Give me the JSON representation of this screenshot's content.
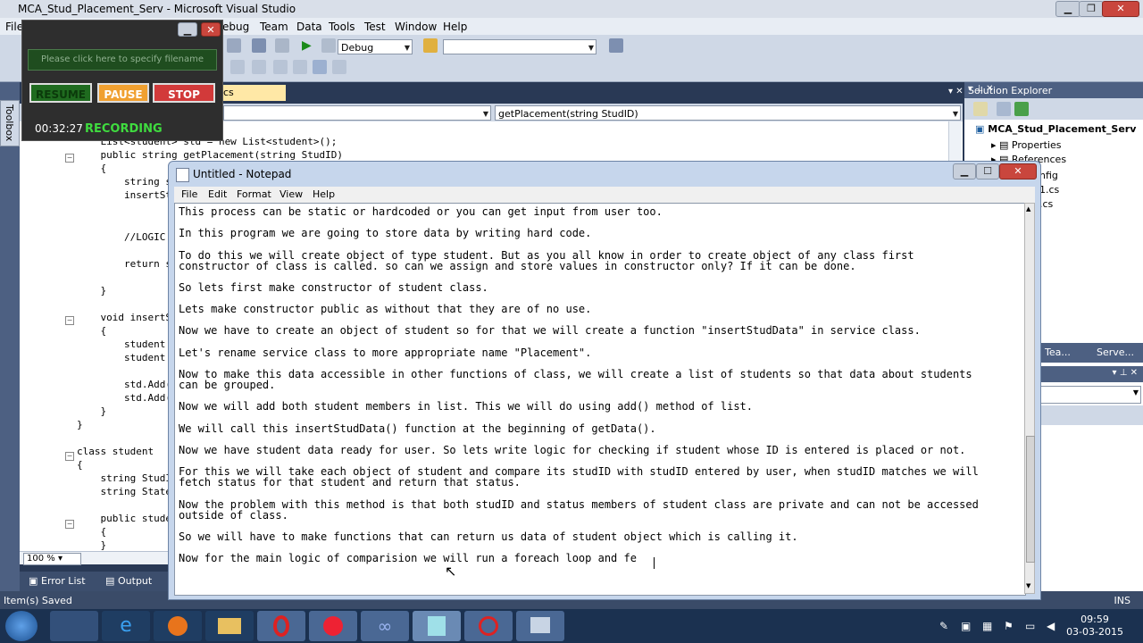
{
  "vs": {
    "title": "MCA_Stud_Placement_Serv - Microsoft Visual Studio",
    "menu": [
      "File",
      "ebug",
      "Team",
      "Data",
      "Tools",
      "Test",
      "Window",
      "Help"
    ],
    "config_combo": "Debug",
    "platform_combo": "",
    "toolbox_label": "Toolbox",
    "doc_tab": "cs",
    "member_combo": "getPlacement(string StudID)",
    "zoom": "100 %",
    "bottom_tabs": [
      "Error List",
      "Output"
    ],
    "status_left": "Item(s) Saved",
    "status_right": "INS",
    "code_lines": [
      "    List<student> std = new List<student>();",
      "    public string getPlacement(string StudID)",
      "    {",
      "        string s",
      "        insertSt",
      "",
      "        //LOGIC",
      "",
      "        return s",
      "",
      "    }",
      "",
      "    void insertS",
      "    {",
      "        student",
      "        student",
      "",
      "        std.Add(",
      "        std.Add(",
      "    }",
      "}",
      "",
      "class student",
      "{",
      "    string StudI",
      "    string State",
      "",
      "    public stude",
      "    {",
      "    }"
    ]
  },
  "solution_explorer": {
    "title": "Solution Explorer",
    "project": "MCA_Stud_Placement_Serv",
    "items": [
      "Properties",
      "References",
      "nfig",
      "1.cs",
      ".cs"
    ],
    "bottom_tabs": [
      "Tea...",
      "Serve..."
    ]
  },
  "recorder": {
    "filename_hint": "Please click here to specify filename",
    "resume": "RESUME",
    "pause": "PAUSE",
    "stop": "STOP",
    "time": "00:32:27",
    "state": "RECORDING"
  },
  "notepad": {
    "title": "Untitled - Notepad",
    "menu": [
      "File",
      "Edit",
      "Format",
      "View",
      "Help"
    ],
    "lines": [
      "This process can be static or hardcoded or you can get input from user too.",
      "In this program we are going to store data by writing hard code.",
      "To do this we will create object of type student. But as you all know in order to create object of any class first",
      "constructor of class is called. so can we assign and store values in constructor only? If it can be done.",
      "So lets first make constructor of student class.",
      "Lets make constructor public as without that they are of no use.",
      "Now we have to create an object of student so for that we will create a function \"insertStudData\" in service class.",
      "Let's rename service class to more appropriate name \"Placement\".",
      "Now to make this data accessible in other functions of class, we will create a list of students so that data about students",
      "can be grouped.",
      "Now we will add both student members in list. This we will do using add() method of list.",
      "We will call this insertStudData() function at the beginning of getData().",
      "Now we have student data ready for user. So lets write logic for checking if student whose ID is entered is placed or not.",
      "For this we will take each object of student and compare its studID with studID entered by user, when studID matches we will",
      "fetch status for that student and return that status.",
      "Now the problem with this method is that both studID and status members of student class are private and can not be accessed",
      "outside of class.",
      "So we will have to make functions that can return us data of student object which is calling it.",
      "Now for the main logic of comparision we will run a foreach loop and fe"
    ]
  },
  "taskbar": {
    "time": "09:59",
    "date": "03-03-2015"
  },
  "colors": {
    "vs_frame": "#293955",
    "recorder_green": "#3fdc3f",
    "stop_red": "#d23a3a",
    "pause_orange": "#f0a030"
  }
}
